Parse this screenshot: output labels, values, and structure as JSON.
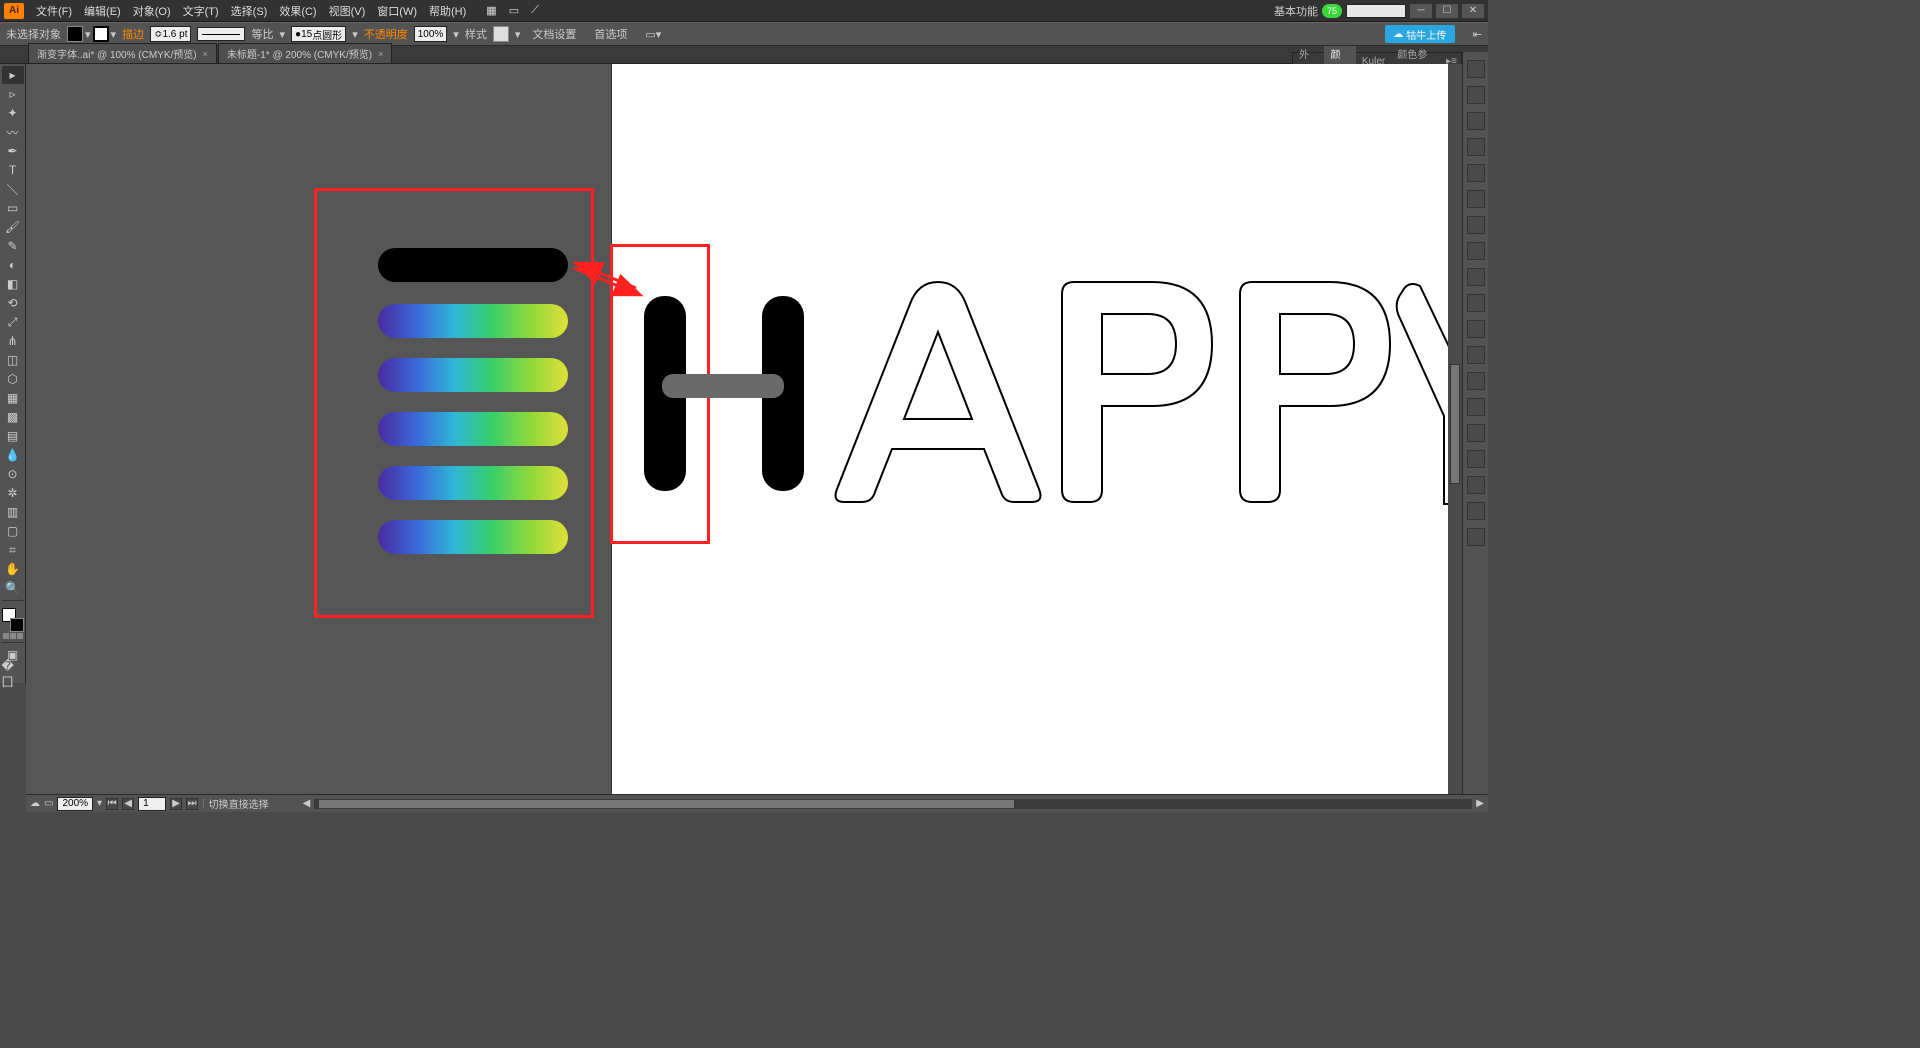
{
  "app_logo": "Ai",
  "menu": [
    "文件(F)",
    "编辑(E)",
    "对象(O)",
    "文字(T)",
    "选择(S)",
    "效果(C)",
    "视图(V)",
    "窗口(W)",
    "帮助(H)"
  ],
  "workspace_label": "基本功能",
  "badge": "75",
  "control": {
    "no_selection": "未选择对象",
    "stroke_label": "描边",
    "stroke_weight": "1.6 pt",
    "stroke_profile": "等比",
    "brush_size": "15",
    "brush_name": "点圆形",
    "opacity_label": "不透明度",
    "opacity_value": "100%",
    "style_label": "样式",
    "doc_setup": "文档设置",
    "prefs": "首选项",
    "cloud_btn": "牯牛上传"
  },
  "tabs": [
    {
      "label": "渐变字体..ai* @ 100% (CMYK/预览)"
    },
    {
      "label": "未标题-1* @ 200% (CMYK/预览)"
    }
  ],
  "panel": {
    "tabs": [
      "外观",
      "颜色",
      "Kuler",
      "颜色参考"
    ],
    "active": 1
  },
  "status": {
    "zoom": "200%",
    "page": "1",
    "tool_hint": "切换直接选择"
  },
  "artwork_text": "HAPPY"
}
